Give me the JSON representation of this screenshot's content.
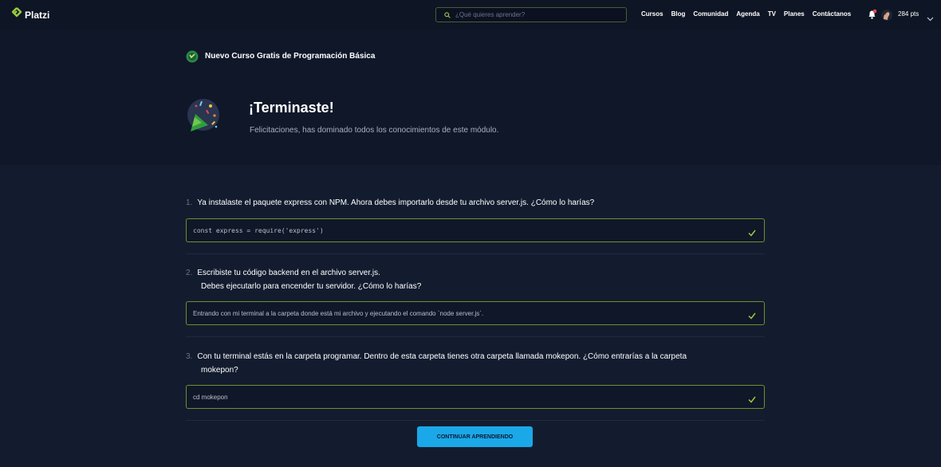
{
  "header": {
    "logo": "Platzi",
    "search_placeholder": "¿Qué quieres aprender?",
    "nav": [
      "Cursos",
      "Blog",
      "Comunidad",
      "Agenda",
      "TV",
      "Planes",
      "Contáctanos"
    ],
    "points": "284 pts"
  },
  "hero": {
    "course_title": "Nuevo Curso Gratis de Programación Básica",
    "finish_title": "¡Terminaste!",
    "finish_subtitle": "Felicitaciones, has dominado todos los conocimientos de este módulo."
  },
  "questions": [
    {
      "number": "1.",
      "lines": [
        "Ya instalaste el paquete express con NPM. Ahora debes importarlo desde tu archivo server.js. ¿Cómo lo harías?"
      ],
      "answer": "const express = require('express')"
    },
    {
      "number": "2.",
      "lines": [
        "Escribiste tu código backend en el archivo server.js.",
        "Debes ejecutarlo para encender tu servidor. ¿Cómo lo harías?"
      ],
      "answer": "Entrando con mi terminal a la carpeta donde está mi archivo y ejecutando el comando `node server.js`."
    },
    {
      "number": "3.",
      "lines": [
        "Con tu terminal estás en la carpeta programar. Dentro de esta carpeta tienes otra carpeta llamada mokepon. ¿Cómo entrarías a la carpeta",
        "mokepon?"
      ],
      "answer": "cd mokepon"
    }
  ],
  "continue_label": "CONTINUAR APRENDIENDO",
  "colors": {
    "accent_green": "#98ca3f",
    "button_blue": "#1ba8e8",
    "background": "#131c2f"
  }
}
